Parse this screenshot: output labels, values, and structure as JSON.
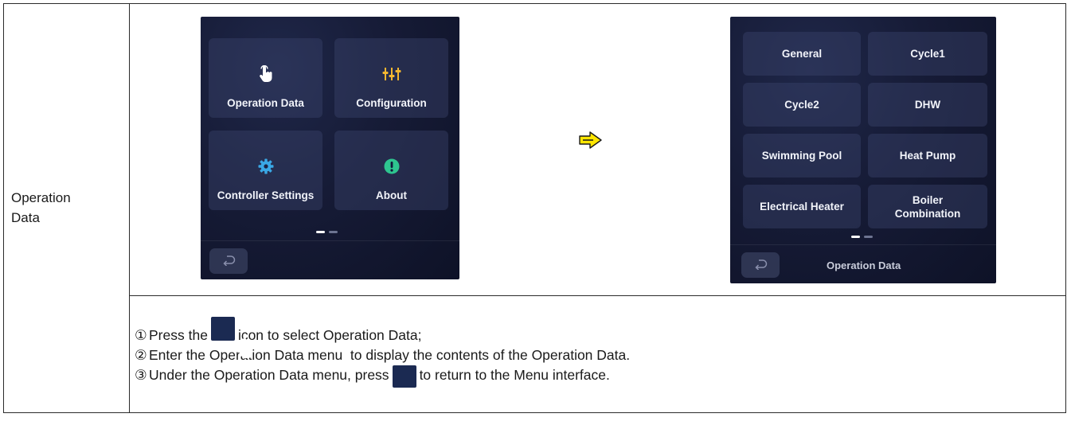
{
  "row_label": "Operation\nData",
  "menu_screen": {
    "tiles": [
      {
        "label": "Operation Data",
        "icon": "hand-pointer-icon"
      },
      {
        "label": "Configuration",
        "icon": "sliders-icon"
      },
      {
        "label": "Controller Settings",
        "icon": "gear-icon"
      },
      {
        "label": "About",
        "icon": "exclamation-icon"
      }
    ],
    "back_icon": "return-arrow-icon",
    "page_dots": 2
  },
  "arrow_icon": "right-arrow-icon",
  "operation_data_screen": {
    "tiles": [
      "General",
      "Cycle1",
      "Cycle2",
      "DHW",
      "Swimming Pool",
      "Heat Pump",
      "Electrical Heater",
      "Boiler\nCombination"
    ],
    "breadcrumb": "Operation Data",
    "back_icon": "return-arrow-icon",
    "page_dots": 2
  },
  "colors": {
    "icon_white": "#ffffff",
    "icon_yellow": "#f5b730",
    "icon_blue": "#3aa8e6",
    "icon_green": "#2ec58f",
    "arrow_yellow": "#ffe600"
  },
  "instructions": {
    "line1": {
      "num": "①",
      "before": "Press the",
      "after": "icon to select Operation Data;"
    },
    "line2": {
      "num": "②",
      "text": "Enter the Operation Data menu  to display the contents of the Operation Data."
    },
    "line3": {
      "num": "③",
      "before": "Under the Operation Data menu, press",
      "after": "to return to the Menu interface."
    }
  }
}
